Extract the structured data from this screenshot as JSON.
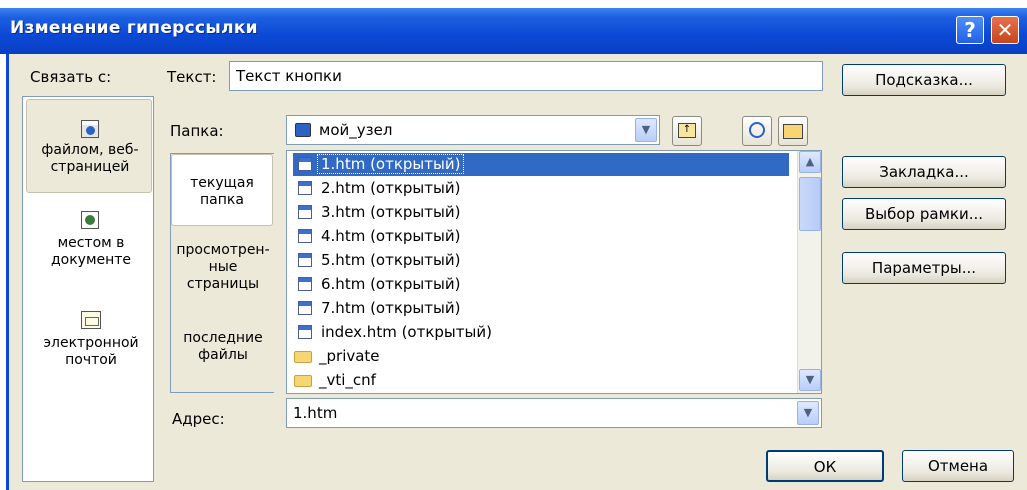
{
  "window": {
    "title": "Изменение гиперссылки",
    "help_glyph": "?",
    "close_glyph": "✕"
  },
  "link_to": {
    "label": "Связать с:",
    "items": [
      {
        "label": "файлом, веб-страницей",
        "icon": "web-page-icon",
        "selected": true
      },
      {
        "label": "местом в документе",
        "icon": "document-place-icon"
      },
      {
        "label": "электронной почтой",
        "icon": "email-icon"
      }
    ]
  },
  "text_field": {
    "label": "Текст:",
    "value": "Текст кнопки"
  },
  "folder": {
    "label": "Папка:",
    "value": "мой_узел"
  },
  "places": [
    {
      "label": "текущая папка",
      "selected": true
    },
    {
      "label": "просмотрен-ные страницы"
    },
    {
      "label": "последние файлы"
    }
  ],
  "files": [
    {
      "name": "1.htm (открытый)",
      "type": "file",
      "selected": true
    },
    {
      "name": "2.htm (открытый)",
      "type": "file"
    },
    {
      "name": "3.htm (открытый)",
      "type": "file"
    },
    {
      "name": "4.htm (открытый)",
      "type": "file"
    },
    {
      "name": "5.htm (открытый)",
      "type": "file"
    },
    {
      "name": "6.htm (открытый)",
      "type": "file"
    },
    {
      "name": "7.htm (открытый)",
      "type": "file"
    },
    {
      "name": "index.htm (открытый)",
      "type": "file"
    },
    {
      "name": "_private",
      "type": "folder"
    },
    {
      "name": "_vti_cnf",
      "type": "folder"
    }
  ],
  "address": {
    "label": "Адрес:",
    "value": "1.htm"
  },
  "buttons": {
    "tooltip": "Подсказка...",
    "bookmark": "Закладка...",
    "frame": "Выбор рамки...",
    "params": "Параметры...",
    "ok": "ОК",
    "cancel": "Отмена"
  },
  "colors": {
    "title_bar": "#0a49d6",
    "selection": "#316ac5",
    "dialog_bg": "#ece9d8"
  }
}
